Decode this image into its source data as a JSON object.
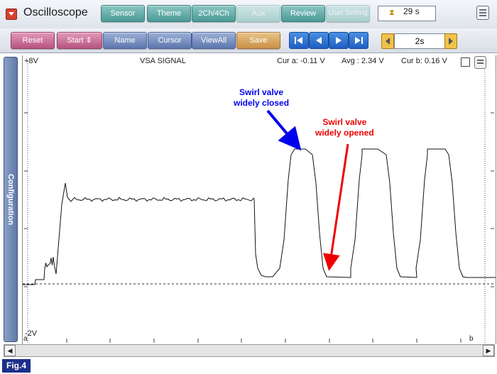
{
  "app": {
    "title": "Oscilloscope"
  },
  "top_buttons": {
    "sensor": "Sensor",
    "theme": "Theme",
    "channels": "2Ch/4Ch",
    "aux": "Aux",
    "review": "Review",
    "user_setting": "User Setting"
  },
  "timer": {
    "value": "29 s",
    "icon": "hourglass-icon"
  },
  "toolbar": {
    "reset": "Reset",
    "start": "Start",
    "name": "Name",
    "cursor": "Cursor",
    "viewall": "ViewAll",
    "save": "Save"
  },
  "zoom": {
    "value": "2s"
  },
  "side_tab": {
    "label": "Configuration"
  },
  "plot": {
    "y_top": "+8V",
    "y_bottom": "-2V",
    "signal_name": "VSA SIGNAL",
    "cursor_a": "Cur a: -0.11 V",
    "avg": "Avg : 2.34 V",
    "cursor_b": "Cur b: 0.16 V",
    "marker_a": "a",
    "marker_b": "b"
  },
  "annotations": {
    "closed_line1": "Swirl valve",
    "closed_line2": "widely closed",
    "opened_line1": "Swirl valve",
    "opened_line2": "widely opened",
    "closed_color": "#0000ee",
    "opened_color": "#ee0000"
  },
  "figure_label": "Fig.4"
}
